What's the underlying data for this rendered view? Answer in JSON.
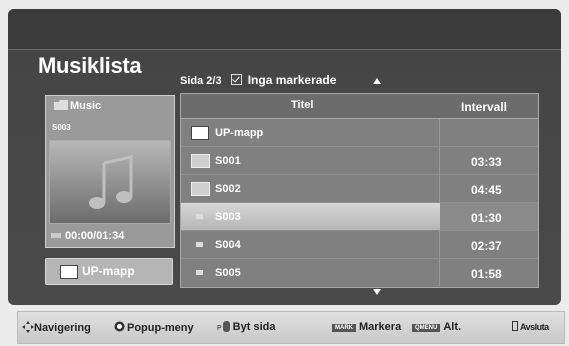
{
  "title": "Musiklista",
  "page_info": "Sida 2/3",
  "mark_info": "Inga markerade",
  "left_panel": {
    "folder_label": "Music",
    "track": "S003",
    "time": "00:00/01:34",
    "up_button": "UP-mapp"
  },
  "list": {
    "col_title": "Titel",
    "col_duration": "Intervall",
    "rows": [
      {
        "name": "UP-mapp",
        "duration": ""
      },
      {
        "name": "S001",
        "duration": "03:33"
      },
      {
        "name": "S002",
        "duration": "04:45"
      },
      {
        "name": "S003",
        "duration": "01:30"
      },
      {
        "name": "S004",
        "duration": "02:37"
      },
      {
        "name": "S005",
        "duration": "01:58"
      }
    ]
  },
  "bottom_bar": {
    "navigation": "Navigering",
    "popup": "Popup-meny",
    "page_tag": "P",
    "page": "Byt sida",
    "mark_tag": "MARK",
    "mark": "Markera",
    "qmenu_tag": "QMENU",
    "alt": "Alt.",
    "exit": "Avsluta"
  },
  "icons": [
    "folder-icon",
    "music-note-icon",
    "up-folder-icon",
    "checkbox-icon",
    "arrow-up-icon",
    "arrow-down-icon",
    "navigation-icon",
    "ok-icon",
    "exit-icon"
  ]
}
